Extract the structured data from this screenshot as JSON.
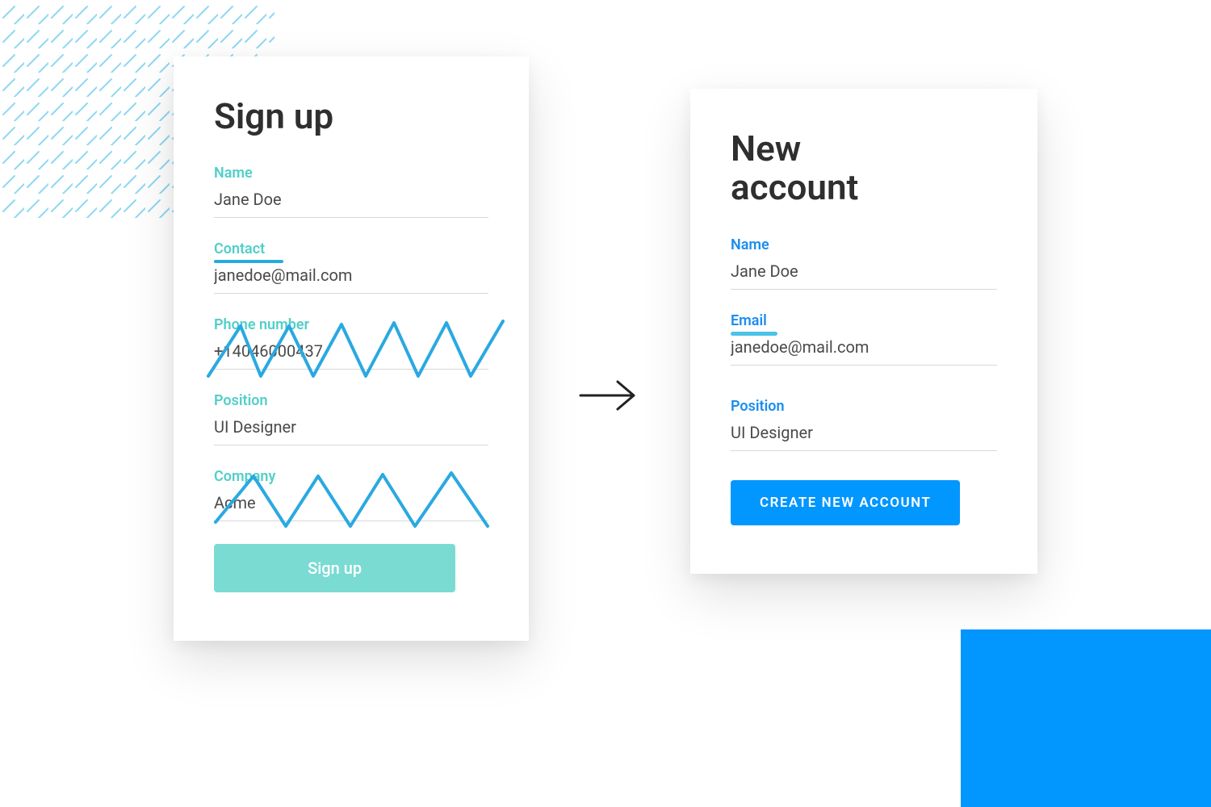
{
  "left_card": {
    "title": "Sign up",
    "fields": {
      "name": {
        "label": "Name",
        "value": "Jane Doe"
      },
      "contact": {
        "label": "Contact",
        "value": "janedoe@mail.com"
      },
      "phone": {
        "label": "Phone number",
        "value": "+14046000437"
      },
      "position": {
        "label": "Position",
        "value": "UI Designer"
      },
      "company": {
        "label": "Company",
        "value": "Acme"
      }
    },
    "button": "Sign up"
  },
  "right_card": {
    "title": "New\naccount",
    "fields": {
      "name": {
        "label": "Name",
        "value": "Jane Doe"
      },
      "email": {
        "label": "Email",
        "value": "janedoe@mail.com"
      },
      "position": {
        "label": "Position",
        "value": "UI Designer"
      }
    },
    "button": "Create new account"
  },
  "colors": {
    "teal": "#52cfc9",
    "teal_btn": "#7adbd3",
    "blue": "#0296ff",
    "blue_label": "#1a8df0",
    "scribble": "#2aa9e0"
  }
}
